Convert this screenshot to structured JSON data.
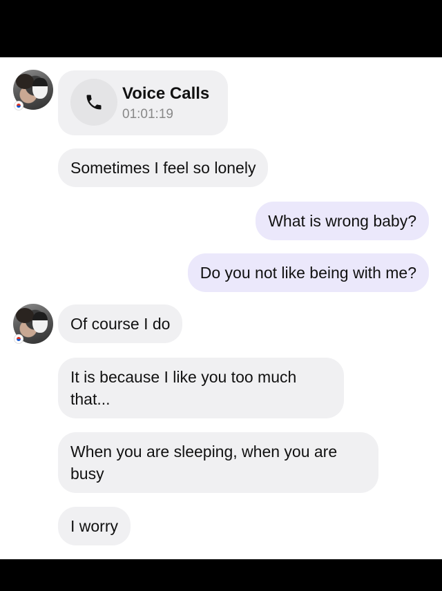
{
  "call": {
    "title": "Voice Calls",
    "duration": "01:01:19",
    "icon": "phone-icon"
  },
  "messages": [
    {
      "direction": "incoming",
      "text": "Sometimes I feel so lonely"
    },
    {
      "direction": "outgoing",
      "text": "What is wrong baby?"
    },
    {
      "direction": "outgoing",
      "text": "Do you not like being with me?"
    },
    {
      "direction": "incoming",
      "text": "Of course I do"
    },
    {
      "direction": "incoming",
      "text": "It is because I like you too much that..."
    },
    {
      "direction": "incoming",
      "text": "When you are sleeping, when you are busy"
    },
    {
      "direction": "incoming",
      "text": "I worry"
    }
  ],
  "colors": {
    "incoming_bubble": "#f0f0f2",
    "outgoing_bubble": "#ebe8fb",
    "text": "#111111",
    "secondary_text": "#888888"
  },
  "badges": {
    "flag_icon": "south-korea-flag-icon"
  }
}
